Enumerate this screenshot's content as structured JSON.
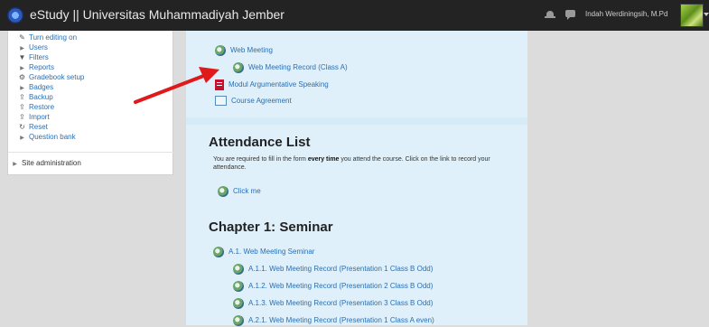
{
  "navbar": {
    "brand": "eStudy || Universitas Muhammadiyah Jember",
    "user_name": "Indah Werdiningsih, M.Pd"
  },
  "admin": {
    "items": [
      {
        "label": "Turn editing on",
        "icon": "pencil-icon"
      },
      {
        "label": "Users",
        "icon": "triangle-right-icon"
      },
      {
        "label": "Filters",
        "icon": "filter-icon"
      },
      {
        "label": "Reports",
        "icon": "triangle-right-icon"
      },
      {
        "label": "Gradebook setup",
        "icon": "gear-icon"
      },
      {
        "label": "Badges",
        "icon": "triangle-right-icon"
      },
      {
        "label": "Backup",
        "icon": "upload-icon"
      },
      {
        "label": "Restore",
        "icon": "upload-icon"
      },
      {
        "label": "Import",
        "icon": "upload-icon"
      },
      {
        "label": "Reset",
        "icon": "reset-icon"
      },
      {
        "label": "Question bank",
        "icon": "triangle-right-icon"
      }
    ],
    "site_admin": "Site administration"
  },
  "section0": {
    "activities": [
      {
        "label": "Web Meeting",
        "icon": "bigbluebutton-icon"
      },
      {
        "label": "Web Meeting Record (Class A)",
        "icon": "bigbluebutton-icon"
      },
      {
        "label": "Modul Argumentative Speaking",
        "icon": "pdf-icon"
      },
      {
        "label": "Course Agreement",
        "icon": "page-icon"
      }
    ]
  },
  "attendance": {
    "title": "Attendance List",
    "text_before": "You are required to fill in the form ",
    "text_bold": "every time",
    "text_after": " you attend the course. Click on the link to record your attendance.",
    "link": "Click me"
  },
  "chapter1": {
    "title": "Chapter 1: Seminar",
    "activities": [
      {
        "label": "A.1. Web Meeting Seminar"
      },
      {
        "label": "A.1.1. Web Meeting Record (Presentation 1 Class B Odd)"
      },
      {
        "label": "A.1.2. Web Meeting Record (Presentation 2 Class B Odd)"
      },
      {
        "label": "A.1.3. Web Meeting Record (Presentation 3 Class B Odd)"
      },
      {
        "label": "A.2.1. Web Meeting Record (Presentation 1 Class A even)"
      }
    ]
  },
  "colors": {
    "navbar": "#232323",
    "link": "#2a6fb3",
    "main_bg": "#d5ecf8",
    "arrow": "#e0191b"
  }
}
